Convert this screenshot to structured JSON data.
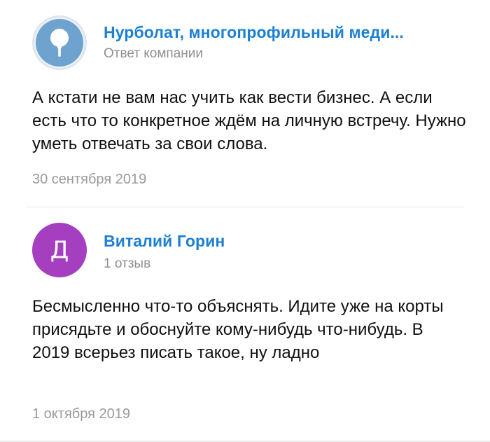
{
  "reviews": [
    {
      "author": "Нурболат, многопрофильный меди...",
      "subline": "Ответ компании",
      "avatar_icon": "location-pin-icon",
      "avatar_color": "#6ea3cf",
      "text": "А кстати не вам нас учить как вести бизнес. А если есть что то конкретное ждём на личную встречу. Нужно уметь отвечать за свои слова.",
      "date": "30 сентября 2019"
    },
    {
      "author": "Виталий Горин",
      "subline": "1 отзыв",
      "avatar_letter": "Д",
      "avatar_color": "#a53fbf",
      "text": "Бесмысленно что-то объяснять. Идите уже на корты присядьте и обоснуйте кому-нибудь что-нибудь. В 2019 всерьез писать такое, ну ладно",
      "date": "1 октября 2019"
    }
  ],
  "colors": {
    "author_link": "#1d7fd1",
    "muted": "#8f8f8f",
    "body_text": "#111111"
  }
}
